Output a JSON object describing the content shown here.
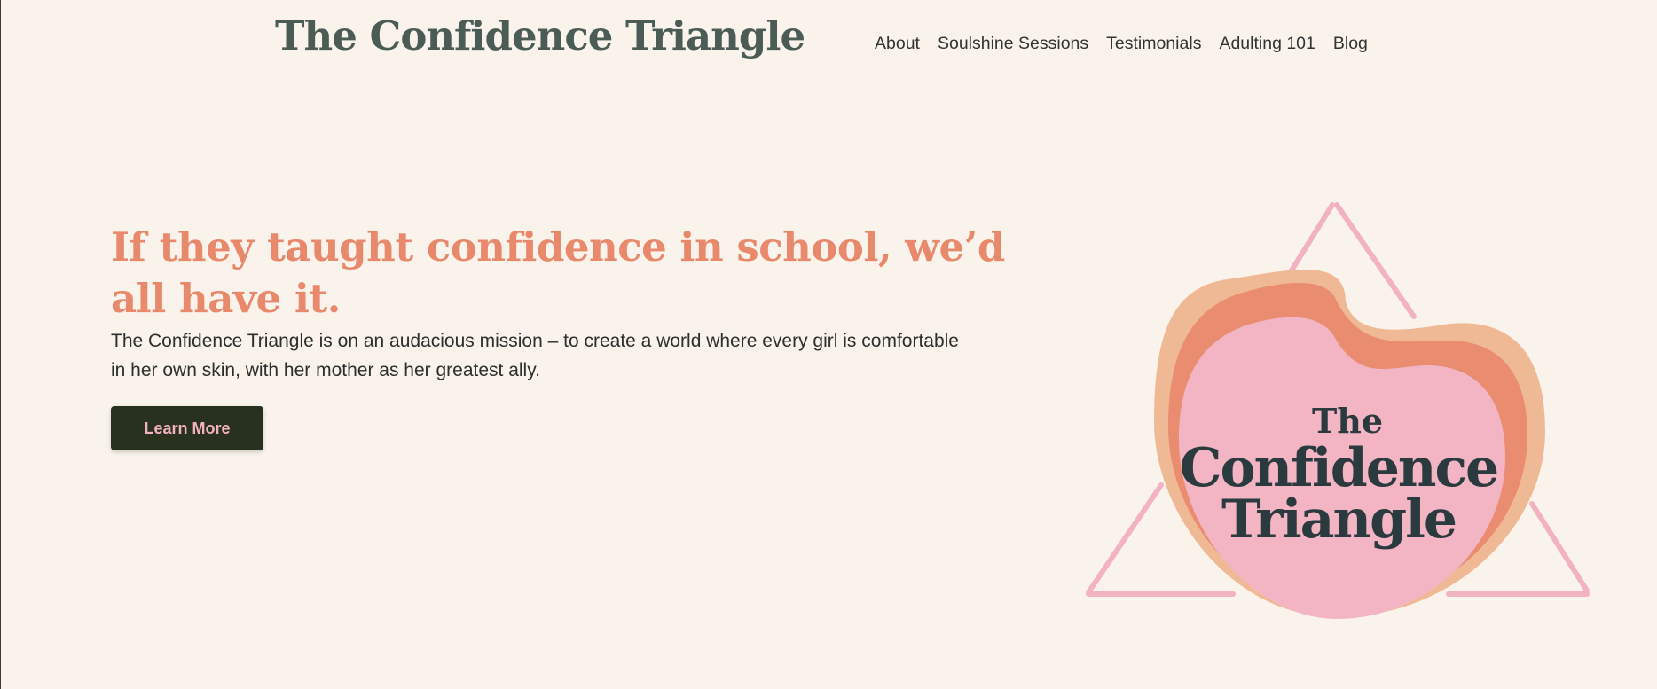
{
  "header": {
    "site_title": "The Confidence Triangle"
  },
  "nav": {
    "items": [
      {
        "label": "About"
      },
      {
        "label": "Soulshine Sessions"
      },
      {
        "label": "Testimonials"
      },
      {
        "label": "Adulting 101"
      },
      {
        "label": "Blog"
      }
    ]
  },
  "hero": {
    "headline": "If they taught confidence in school, we’d all have it.",
    "body": "The Confidence Triangle is on an audacious mission – to create a world where every girl is comfortable in her own skin, with her mother as her greatest ally.",
    "cta_label": "Learn More"
  },
  "logo": {
    "line1": "The",
    "line2": "Confidence",
    "line3": "Triangle"
  },
  "colors": {
    "background": "#f9f3ec",
    "title": "#4b5c57",
    "headline": "#e9896b",
    "cta_bg": "#28311e",
    "cta_text": "#f3b2c0",
    "heart_pink": "#f3b5c3",
    "heart_salmon": "#e98c70",
    "heart_peach": "#f0b996",
    "triangle": "#f2b2c0"
  }
}
